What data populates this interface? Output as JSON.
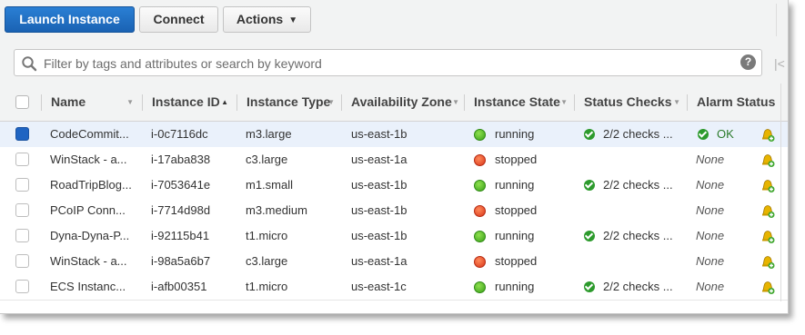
{
  "toolbar": {
    "launch_label": "Launch Instance",
    "connect_label": "Connect",
    "actions_label": "Actions"
  },
  "filter": {
    "placeholder": "Filter by tags and attributes or search by keyword",
    "help": "?",
    "pager_first": "|<"
  },
  "columns": {
    "name": "Name",
    "instance_id": "Instance ID",
    "instance_type": "Instance Type",
    "availability_zone": "Availability Zone",
    "instance_state": "Instance State",
    "status_checks": "Status Checks",
    "alarm_status": "Alarm Status"
  },
  "rows": [
    {
      "name": "CodeCommit...",
      "id": "i-0c7116dc",
      "type": "m3.large",
      "zone": "us-east-1b",
      "state": "running",
      "checks": "2/2 checks ...",
      "alarm": "OK",
      "selected": true
    },
    {
      "name": "WinStack - a...",
      "id": "i-17aba838",
      "type": "c3.large",
      "zone": "us-east-1a",
      "state": "stopped",
      "checks": "",
      "alarm": "None",
      "selected": false
    },
    {
      "name": "RoadTripBlog...",
      "id": "i-7053641e",
      "type": "m1.small",
      "zone": "us-east-1b",
      "state": "running",
      "checks": "2/2 checks ...",
      "alarm": "None",
      "selected": false
    },
    {
      "name": "PCoIP Conn...",
      "id": "i-7714d98d",
      "type": "m3.medium",
      "zone": "us-east-1b",
      "state": "stopped",
      "checks": "",
      "alarm": "None",
      "selected": false
    },
    {
      "name": "Dyna-Dyna-P...",
      "id": "i-92115b41",
      "type": "t1.micro",
      "zone": "us-east-1b",
      "state": "running",
      "checks": "2/2 checks ...",
      "alarm": "None",
      "selected": false
    },
    {
      "name": "WinStack - a...",
      "id": "i-98a5a6b7",
      "type": "c3.large",
      "zone": "us-east-1a",
      "state": "stopped",
      "checks": "",
      "alarm": "None",
      "selected": false
    },
    {
      "name": "ECS Instanc...",
      "id": "i-afb00351",
      "type": "t1.micro",
      "zone": "us-east-1c",
      "state": "running",
      "checks": "2/2 checks ...",
      "alarm": "None",
      "selected": false
    }
  ],
  "icons": {
    "running": "running-state-icon",
    "stopped": "stopped-state-icon",
    "check": "status-check-icon",
    "alarm": "create-alarm-icon"
  },
  "colors": {
    "primary": "#1f6fc9",
    "running": "#3aa11a",
    "stopped": "#d9361a",
    "ok": "#2a7a2a"
  }
}
